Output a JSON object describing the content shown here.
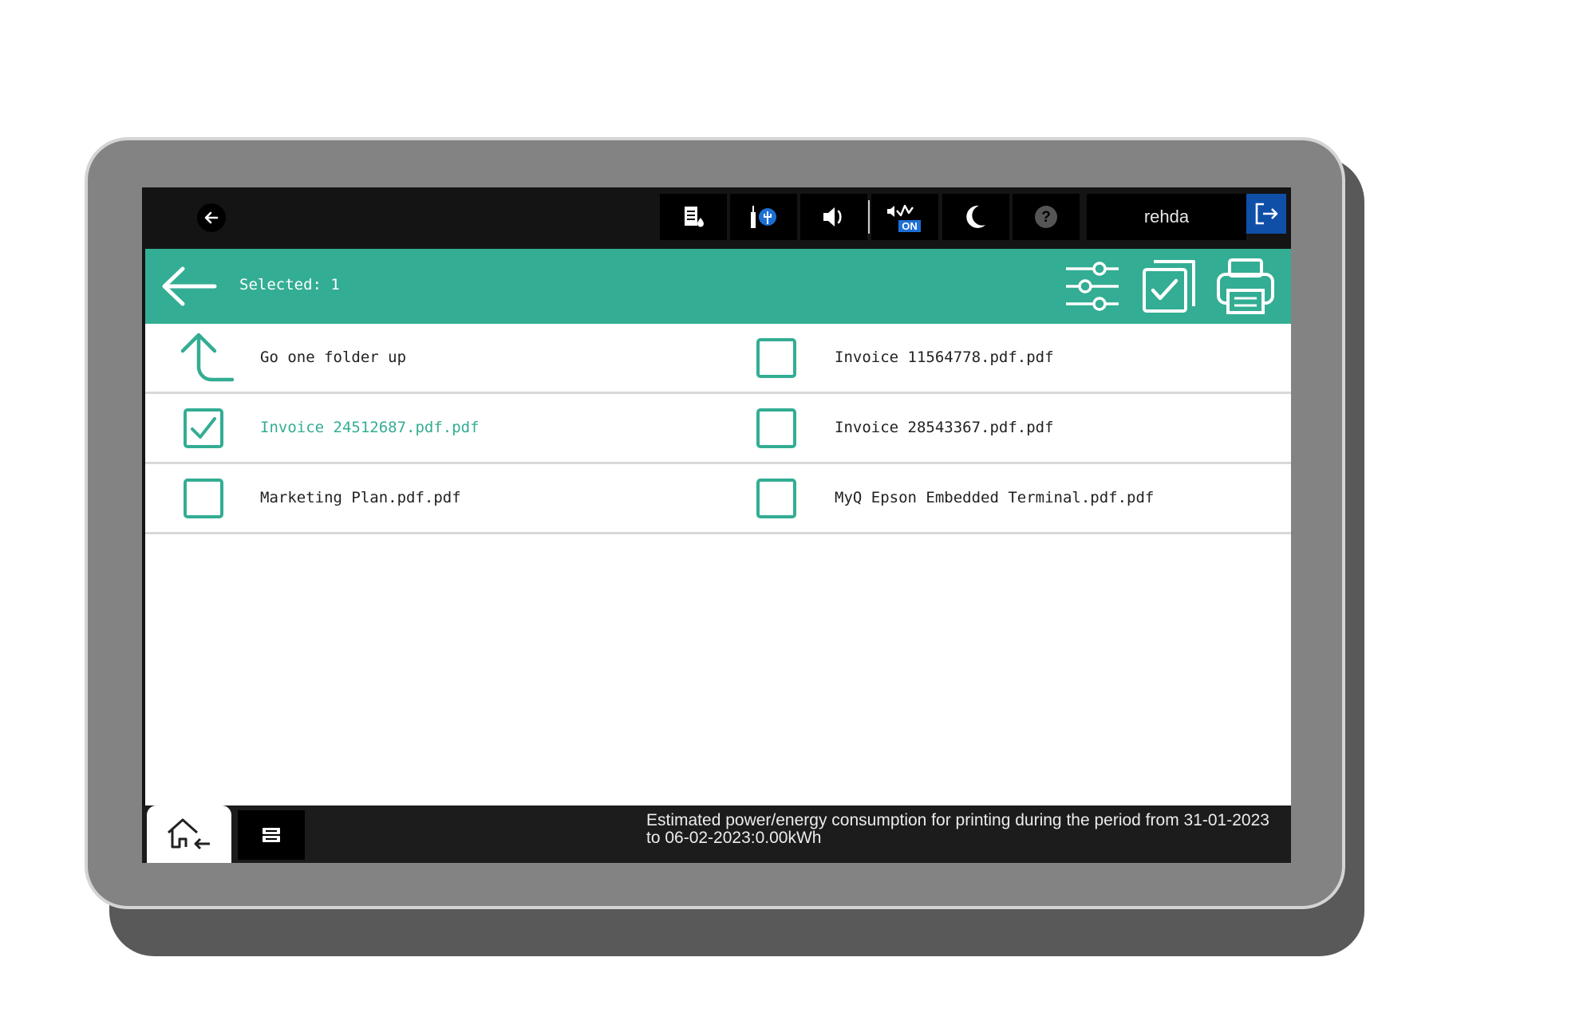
{
  "statusbar": {
    "icons": [
      "back-icon",
      "document-ink-icon",
      "network-usb-icon",
      "volume-icon",
      "eco-on-icon",
      "sleep-moon-icon",
      "help-icon"
    ],
    "eco_badge": "ON",
    "help_symbol": "?",
    "user": "rehda",
    "logout_icon": "logout-icon"
  },
  "appbar": {
    "selected_text": "Selected: 1",
    "actions": [
      "filter-settings-icon",
      "select-all-icon",
      "print-icon"
    ]
  },
  "files": [
    {
      "label": "Go one folder up",
      "type": "folder-up",
      "checked": false
    },
    {
      "label": "Invoice 11564778.pdf.pdf",
      "type": "file",
      "checked": false
    },
    {
      "label": "Invoice 24512687.pdf.pdf",
      "type": "file",
      "checked": true
    },
    {
      "label": "Invoice 28543367.pdf.pdf",
      "type": "file",
      "checked": false
    },
    {
      "label": "Marketing Plan.pdf.pdf",
      "type": "file",
      "checked": false
    },
    {
      "label": "MyQ Epson Embedded Terminal.pdf.pdf",
      "type": "file",
      "checked": false
    }
  ],
  "bottombar": {
    "home_icon": "home-icon",
    "jobs_icon": "jobs-icon",
    "energy_text": "Estimated power/energy consumption for printing during the period from 31-01-2023 to 06-02-2023:0.00kWh"
  },
  "colors": {
    "accent": "#33ad93",
    "logout": "#0f4fa8",
    "bar": "#141414"
  }
}
